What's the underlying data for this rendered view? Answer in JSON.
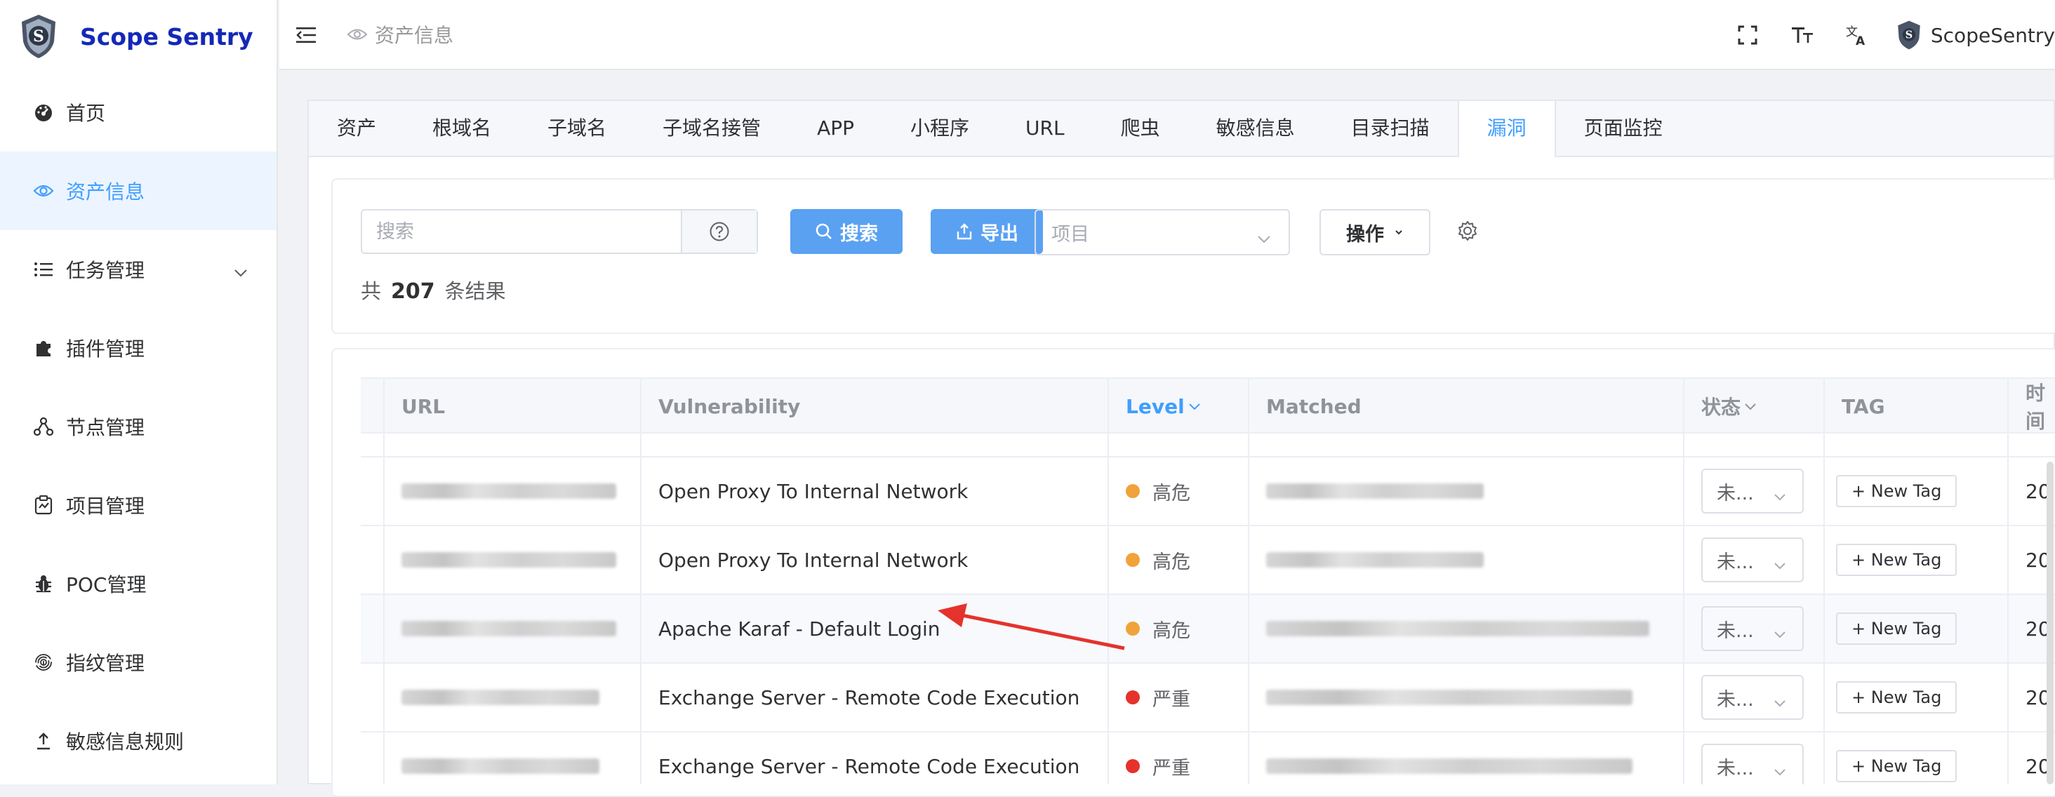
{
  "app": {
    "title": "Scope Sentry",
    "user": "ScopeSentry"
  },
  "sidebar": {
    "items": [
      {
        "label": "首页",
        "icon": "dashboard-icon"
      },
      {
        "label": "资产信息",
        "icon": "eye-icon",
        "active": true
      },
      {
        "label": "任务管理",
        "icon": "list-icon",
        "expandable": true
      },
      {
        "label": "插件管理",
        "icon": "puzzle-icon"
      },
      {
        "label": "节点管理",
        "icon": "nodes-icon"
      },
      {
        "label": "项目管理",
        "icon": "project-icon"
      },
      {
        "label": "POC管理",
        "icon": "bug-icon"
      },
      {
        "label": "指纹管理",
        "icon": "fingerprint-icon"
      },
      {
        "label": "敏感信息规则",
        "icon": "upload-icon"
      }
    ]
  },
  "topbar": {
    "breadcrumb": "资产信息"
  },
  "tabs": [
    "资产",
    "根域名",
    "子域名",
    "子域名接管",
    "APP",
    "小程序",
    "URL",
    "爬虫",
    "敏感信息",
    "目录扫描",
    "漏洞",
    "页面监控"
  ],
  "active_tab": "漏洞",
  "filter": {
    "search_placeholder": "搜索",
    "search_button": "搜索",
    "export_button": "导出",
    "project_placeholder": "项目",
    "operation_button": "操作",
    "total_prefix": "共",
    "total_count": "207",
    "total_suffix": "条结果"
  },
  "table": {
    "headers": [
      "URL",
      "Vulnerability",
      "Level",
      "Matched",
      "状态",
      "TAG",
      "时间"
    ],
    "rows": [
      {
        "vulnerability": "Open Proxy To Internal Network",
        "level": "高危",
        "level_color": "#f0a33a",
        "status": "未...",
        "tag": "+ New Tag",
        "time": "20"
      },
      {
        "vulnerability": "Open Proxy To Internal Network",
        "level": "高危",
        "level_color": "#f0a33a",
        "status": "未...",
        "tag": "+ New Tag",
        "time": "20"
      },
      {
        "vulnerability": "Apache Karaf - Default Login",
        "level": "高危",
        "level_color": "#f0a33a",
        "status": "未...",
        "tag": "+ New Tag",
        "time": "20"
      },
      {
        "vulnerability": "Exchange Server - Remote Code Execution",
        "level": "严重",
        "level_color": "#e5322d",
        "status": "未...",
        "tag": "+ New Tag",
        "time": "20"
      },
      {
        "vulnerability": "Exchange Server - Remote Code Execution",
        "level": "严重",
        "level_color": "#e5322d",
        "status": "未...",
        "tag": "+ New Tag",
        "time": "20"
      }
    ]
  },
  "colors": {
    "accent": "#409eff",
    "annotation_arrow": "#e5322d"
  }
}
